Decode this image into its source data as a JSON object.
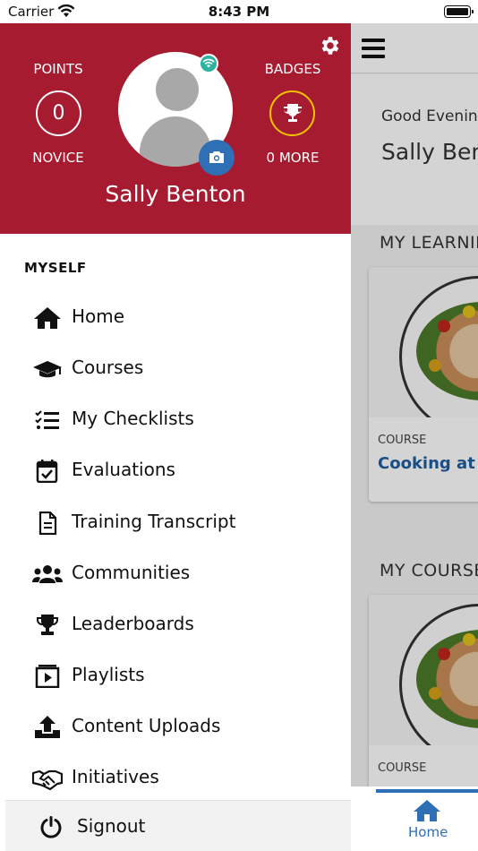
{
  "status_bar": {
    "carrier": "Carrier",
    "time": "8:43 PM"
  },
  "drawer": {
    "points_label": "POINTS",
    "points_value": "0",
    "level": "NOVICE",
    "badges_label": "BADGES",
    "badges_more": "0 MORE",
    "user_name": "Sally Benton",
    "section": "MYSELF",
    "items": [
      {
        "label": "Home",
        "icon": "home-icon"
      },
      {
        "label": "Courses",
        "icon": "graduation-cap-icon"
      },
      {
        "label": "My Checklists",
        "icon": "checklist-icon"
      },
      {
        "label": "Evaluations",
        "icon": "calendar-check-icon"
      },
      {
        "label": "Training Transcript",
        "icon": "document-icon"
      },
      {
        "label": "Communities",
        "icon": "users-icon"
      },
      {
        "label": "Leaderboards",
        "icon": "trophy-icon"
      },
      {
        "label": "Playlists",
        "icon": "playlist-icon"
      },
      {
        "label": "Content Uploads",
        "icon": "upload-icon"
      },
      {
        "label": "Initiatives",
        "icon": "handshake-icon"
      }
    ],
    "signout": "Signout"
  },
  "main": {
    "greeting": "Good Evening",
    "user_name": "Sally Benton",
    "section_learning": "MY LEARNING",
    "section_courses": "MY COURSES",
    "card": {
      "type": "COURSE",
      "title": "Cooking at Home"
    },
    "card2": {
      "type": "COURSE"
    },
    "tab_home": "Home"
  },
  "colors": {
    "brand_red": "#a61b30",
    "accent_blue": "#2f6fb5",
    "badge_gold": "#f2c300",
    "online_teal": "#2bb3a0"
  }
}
